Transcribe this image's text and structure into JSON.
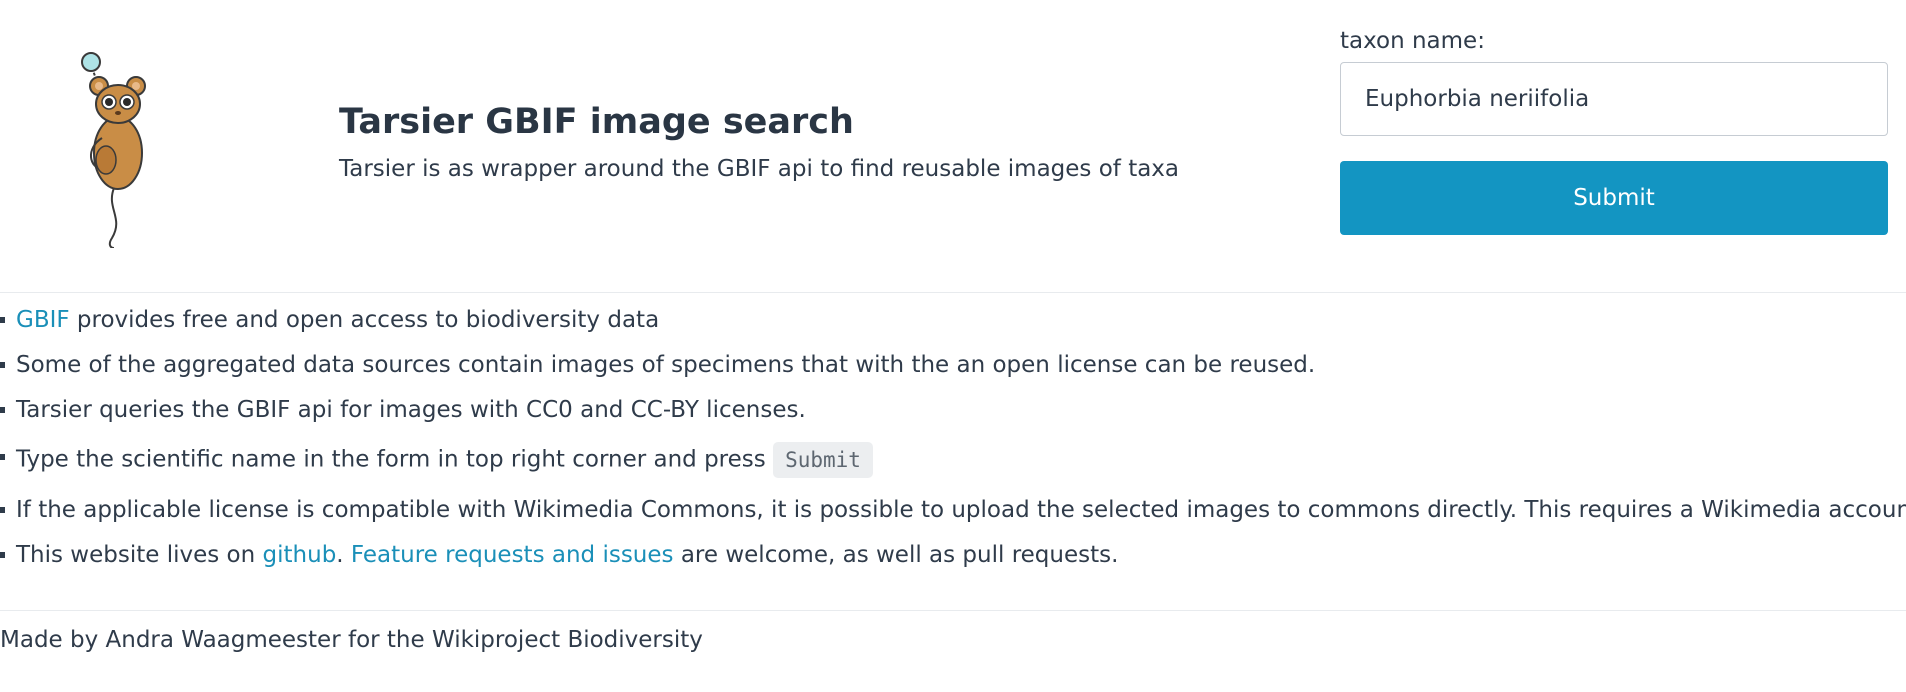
{
  "header": {
    "title": "Tarsier GBIF image search",
    "subtitle": "Tarsier is as wrapper around the GBIF api to find reusable images of taxa",
    "logo_icon": "tarsier-logo-icon"
  },
  "form": {
    "label": "taxon name:",
    "input_value": "Euphorbia neriifolia",
    "submit_label": "Submit"
  },
  "info": {
    "item1": {
      "link": "GBIF",
      "text": " provides free and open access to biodiversity data"
    },
    "item2": {
      "text": "Some of the aggregated data sources contain images of specimens that with the an open license can be reused."
    },
    "item3": {
      "text": "Tarsier queries the GBIF api for images with CC0 and CC-BY licenses."
    },
    "item4": {
      "text": "Type the scientific name in the form in top right corner and press ",
      "code": "Submit"
    },
    "item5": {
      "text": "If the applicable license is compatible with Wikimedia Commons, it is possible to upload the selected images to commons directly. This requires a Wikimedia account."
    },
    "item6": {
      "prefix": "This website lives on ",
      "link1": "github",
      "sep": ". ",
      "link2": "Feature requests and issues",
      "suffix": " are welcome, as well as pull requests."
    }
  },
  "footer": {
    "text": "Made by Andra Waagmeester for the Wikiproject Biodiversity"
  },
  "colors": {
    "accent": "#1395c2",
    "link": "#1a8fb8",
    "text": "#2f3b4a"
  }
}
